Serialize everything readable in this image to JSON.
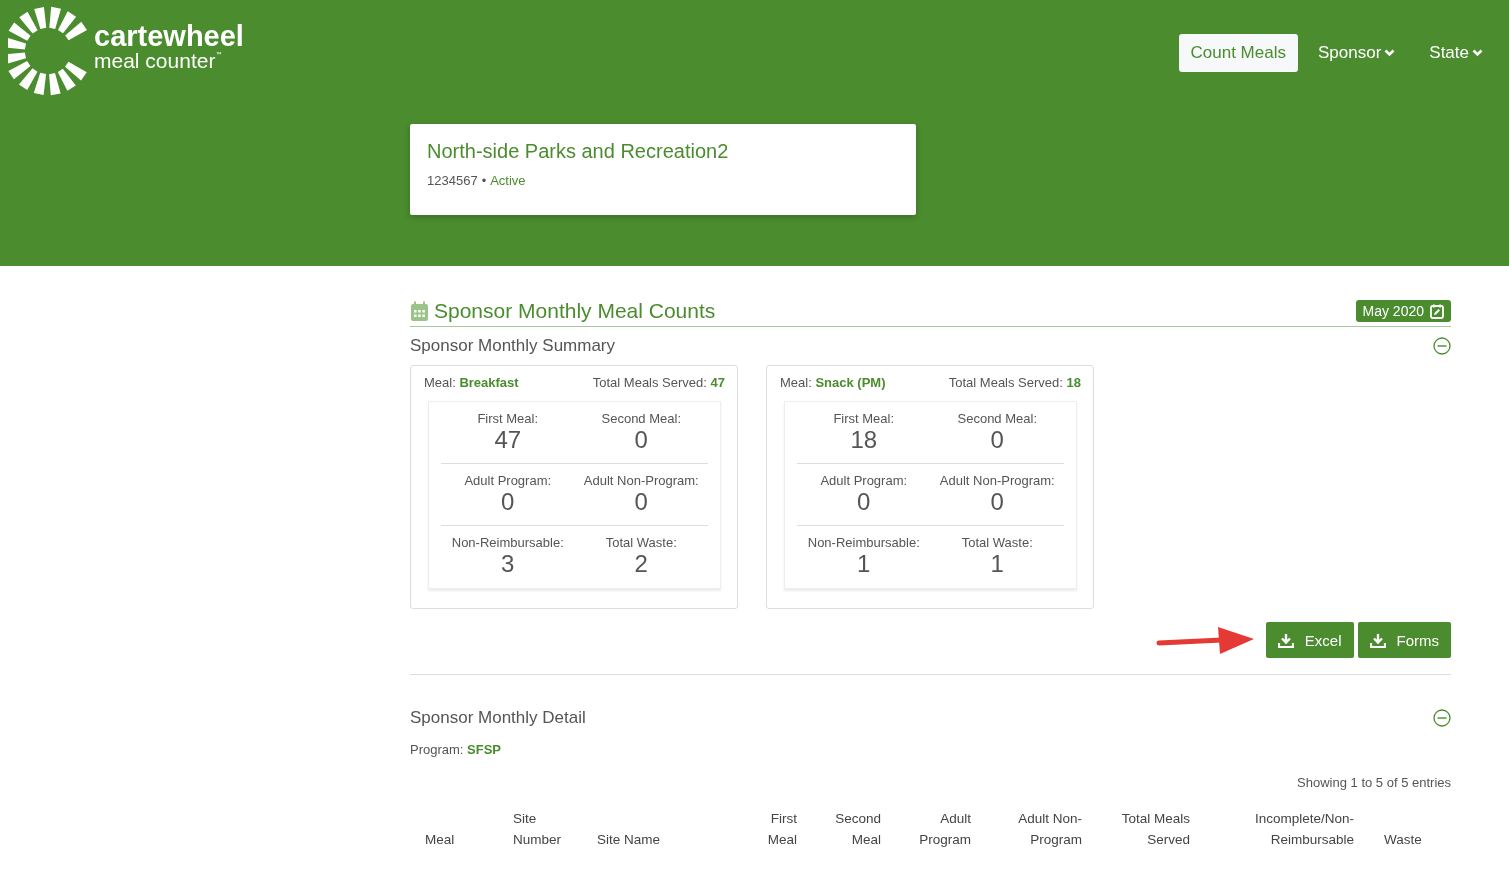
{
  "logo": {
    "name": "cartewheel",
    "tagline": "meal counter",
    "trademark": "™"
  },
  "nav": [
    {
      "label": "Count Meals",
      "kind": "button",
      "selected": true
    },
    {
      "label": "Sponsor",
      "kind": "dropdown",
      "selected": false
    },
    {
      "label": "State",
      "kind": "dropdown",
      "selected": false
    }
  ],
  "sponsor": {
    "name": "North-side Parks and Recreation2",
    "id": "1234567",
    "separator": "•",
    "status": "Active"
  },
  "section": {
    "title": "Sponsor Monthly Meal Counts",
    "month": "May 2020"
  },
  "summary": {
    "title": "Sponsor Monthly Summary",
    "expanded": true,
    "cards": [
      {
        "meal_label": "Meal:",
        "meal": "Breakfast",
        "total_label": "Total Meals Served:",
        "total": "47",
        "stats": [
          {
            "label": "First Meal:",
            "value": "47"
          },
          {
            "label": "Second Meal:",
            "value": "0"
          },
          {
            "label": "Adult Program:",
            "value": "0"
          },
          {
            "label": "Adult Non-Program:",
            "value": "0"
          },
          {
            "label": "Non-Reimbursable:",
            "value": "3"
          },
          {
            "label": "Total Waste:",
            "value": "2"
          }
        ]
      },
      {
        "meal_label": "Meal:",
        "meal": "Snack (PM)",
        "total_label": "Total Meals Served:",
        "total": "18",
        "stats": [
          {
            "label": "First Meal:",
            "value": "18"
          },
          {
            "label": "Second Meal:",
            "value": "0"
          },
          {
            "label": "Adult Program:",
            "value": "0"
          },
          {
            "label": "Adult Non-Program:",
            "value": "0"
          },
          {
            "label": "Non-Reimbursable:",
            "value": "1"
          },
          {
            "label": "Total Waste:",
            "value": "1"
          }
        ]
      }
    ],
    "buttons": [
      "Excel",
      "Forms"
    ]
  },
  "detail": {
    "title": "Sponsor Monthly Detail",
    "expanded": true,
    "program_label": "Program:",
    "program": "SFSP",
    "entries_info": "Showing 1 to 5 of 5 entries",
    "columns": [
      "Meal",
      "Site Number",
      "Site Name",
      "First Meal",
      "Second Meal",
      "Adult Program",
      "Adult Non-Program",
      "Total Meals Served",
      "Incomplete/Non-Reimbursable",
      "Waste"
    ]
  }
}
